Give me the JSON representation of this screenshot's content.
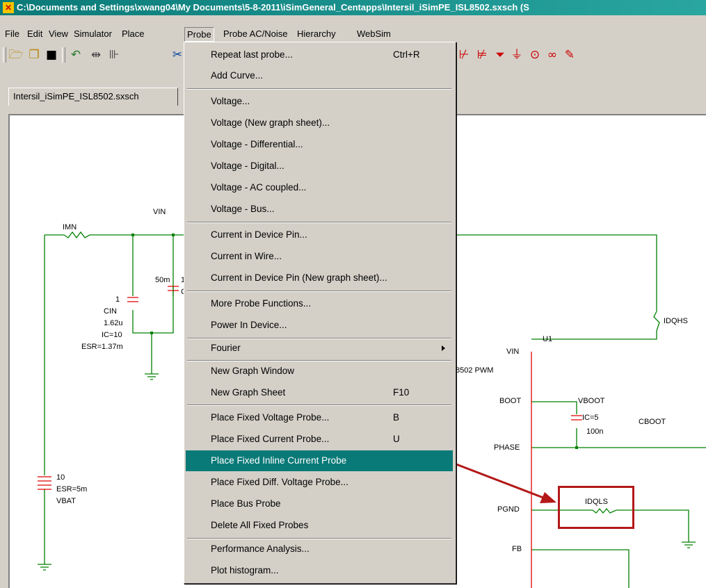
{
  "window": {
    "title": "C:\\Documents and Settings\\xwang04\\My Documents\\5-8-2011\\iSimGeneral_Centapps\\Intersil_iSimPE_ISL8502.sxsch (S"
  },
  "menubar": [
    "File",
    "Edit",
    "View",
    "Simulator",
    "Place",
    "Probe",
    "Probe AC/Noise",
    "Hierarchy",
    "WebSim"
  ],
  "tab": {
    "label": "Intersil_iSimPE_ISL8502.sxsch"
  },
  "probe_menu": {
    "items": [
      {
        "label": "Repeat last probe...",
        "shortcut": "Ctrl+R"
      },
      {
        "label": "Add Curve...",
        "shortcut": ""
      },
      {
        "label": "Voltage...",
        "shortcut": ""
      },
      {
        "label": "Voltage (New graph sheet)...",
        "shortcut": ""
      },
      {
        "label": "Voltage - Differential...",
        "shortcut": ""
      },
      {
        "label": "Voltage - Digital...",
        "shortcut": ""
      },
      {
        "label": "Voltage - AC coupled...",
        "shortcut": ""
      },
      {
        "label": "Voltage - Bus...",
        "shortcut": ""
      },
      {
        "label": "Current in Device Pin...",
        "shortcut": ""
      },
      {
        "label": "Current in Wire...",
        "shortcut": ""
      },
      {
        "label": "Current in Device Pin (New graph sheet)...",
        "shortcut": ""
      },
      {
        "label": "More Probe Functions...",
        "shortcut": ""
      },
      {
        "label": "Power In Device...",
        "shortcut": ""
      },
      {
        "label": "Fourier",
        "shortcut": ""
      },
      {
        "label": "New Graph Window",
        "shortcut": ""
      },
      {
        "label": "New Graph Sheet",
        "shortcut": "F10"
      },
      {
        "label": "Place Fixed Voltage Probe...",
        "shortcut": "B"
      },
      {
        "label": "Place Fixed Current Probe...",
        "shortcut": "U"
      },
      {
        "label": "Place Fixed Inline Current Probe",
        "shortcut": ""
      },
      {
        "label": "Place Fixed Diff. Voltage Probe...",
        "shortcut": ""
      },
      {
        "label": "Place Bus Probe",
        "shortcut": ""
      },
      {
        "label": "Delete All Fixed Probes",
        "shortcut": ""
      },
      {
        "label": "Performance Analysis...",
        "shortcut": ""
      },
      {
        "label": "Plot histogram...",
        "shortcut": ""
      }
    ]
  },
  "schematic": {
    "vin_net": "VIN",
    "imn": "IMN",
    "cin_values": [
      "1",
      "CIN",
      "1.62u",
      "IC=10",
      "ESR=1.37m"
    ],
    "cap2_value": "50m",
    "cap2_frag_1": "1",
    "cap2_frag_2": "C",
    "vbat": [
      "10",
      "ESR=5m",
      "VBAT"
    ],
    "idqhs": "IDQHS",
    "u1": "U1",
    "pwm_label": "8502 PWM",
    "pins": [
      "VIN",
      "BOOT",
      "PHASE",
      "PGND",
      "FB"
    ],
    "vboot": "VBOOT",
    "cboot_values": [
      "IC=5",
      "100n"
    ],
    "cboot": "CBOOT",
    "idqls": "IDQLS"
  },
  "colors": {
    "highlight": "#0a7a78",
    "wire": "#008000",
    "part": "#e00000",
    "callout": "#b41818"
  }
}
